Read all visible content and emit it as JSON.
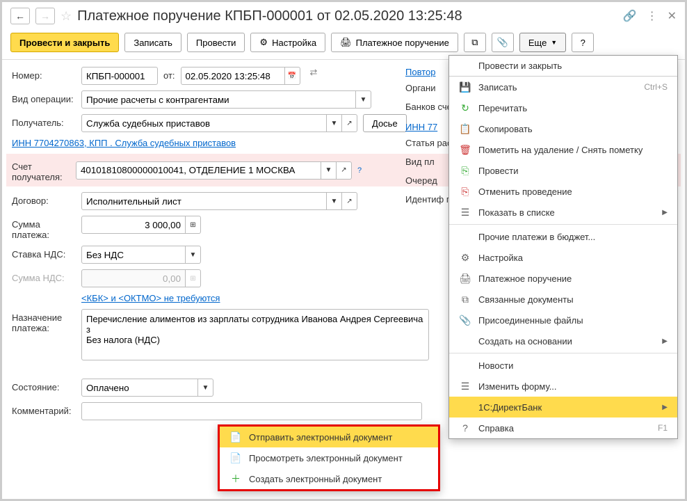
{
  "title": "Платежное поручение КПБП-000001 от 02.05.2020 13:25:48",
  "toolbar": {
    "post_close": "Провести и закрыть",
    "save": "Записать",
    "post": "Провести",
    "settings": "Настройка",
    "print": "Платежное поручение",
    "more": "Еще",
    "help": "?"
  },
  "labels": {
    "number": "Номер:",
    "from": "от:",
    "op_type": "Вид операции:",
    "recipient": "Получатель:",
    "dossier": "Досье",
    "recip_acc": "Счет получателя:",
    "contract": "Договор:",
    "amount": "Сумма платежа:",
    "vat_rate": "Ставка НДС:",
    "vat_amount": "Сумма НДС:",
    "purpose": "Назначение платежа:",
    "state": "Состояние:",
    "comment": "Комментарий:",
    "repeat": "Повтор",
    "org": "Органи",
    "bank_acc": "Банков счет:",
    "inn2": "ИНН 77",
    "expense": "Статья расход",
    "pay_type": "Вид пл",
    "queue": "Очеред",
    "payment_id": "Идентиф платежа"
  },
  "values": {
    "number": "КПБП-000001",
    "date": "02.05.2020 13:25:48",
    "op_type": "Прочие расчеты с контрагентами",
    "recipient": "Служба судебных приставов",
    "recip_link": "ИНН 7704270863, КПП . Служба судебных приставов",
    "recip_acc": "40101810800000010041, ОТДЕЛЕНИЕ 1 МОСКВА",
    "contract": "Исполнительный лист",
    "amount": "3 000,00",
    "vat_rate": "Без НДС",
    "vat_amount": "0,00",
    "kbk_link": "<КБК> и <ОКТМО> не требуются",
    "purpose": "Перечисление алиментов из зарплаты сотрудника Иванова Андрея Сергеевича з\nБез налога (НДС)",
    "state": "Оплачено",
    "q": "?"
  },
  "state_menu": {
    "send": "Отправить электронный документ",
    "view": "Просмотреть электронный документ",
    "create": "Создать электронный документ"
  },
  "more_menu": {
    "post_close": "Провести и закрыть",
    "save": "Записать",
    "save_sc": "Ctrl+S",
    "reread": "Перечитать",
    "copy": "Скопировать",
    "mark_del": "Пометить на удаление / Снять пометку",
    "post": "Провести",
    "unpost": "Отменить проведение",
    "show_list": "Показать в списке",
    "other_budget": "Прочие платежи в бюджет...",
    "settings": "Настройка",
    "print": "Платежное поручение",
    "linked": "Связанные документы",
    "attached": "Присоединенные файлы",
    "create_base": "Создать на основании",
    "news": "Новости",
    "edit_form": "Изменить форму...",
    "directbank": "1С:ДиректБанк",
    "help": "Справка",
    "help_sc": "F1"
  }
}
